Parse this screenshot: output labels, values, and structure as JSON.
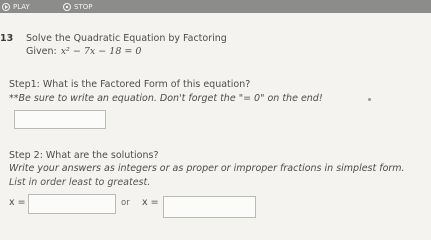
{
  "toolbar": {
    "play_label": "PLAY",
    "stop_label": "STOP",
    "play_icon": "play-icon",
    "stop_icon": "stop-icon"
  },
  "question": {
    "number": "13",
    "title": "Solve the Quadratic Equation by Factoring",
    "given_label": "Given:",
    "given_equation": "x² − 7x − 18 = 0"
  },
  "step1": {
    "prompt": "Step1:  What is the Factored Form of this equation?",
    "note": "**Be sure to write an equation.  Don't forget the \"= 0\" on the end!",
    "answer_value": ""
  },
  "step2": {
    "prompt": "Step 2:  What are the solutions?",
    "instructions": "Write your answers as integers or as proper or improper fractions in simplest form.",
    "list_note": "List in order least to greatest.",
    "x_label_1": "x =",
    "or_label": "or",
    "x_label_2": "x =",
    "answer_1": "",
    "answer_2": ""
  }
}
